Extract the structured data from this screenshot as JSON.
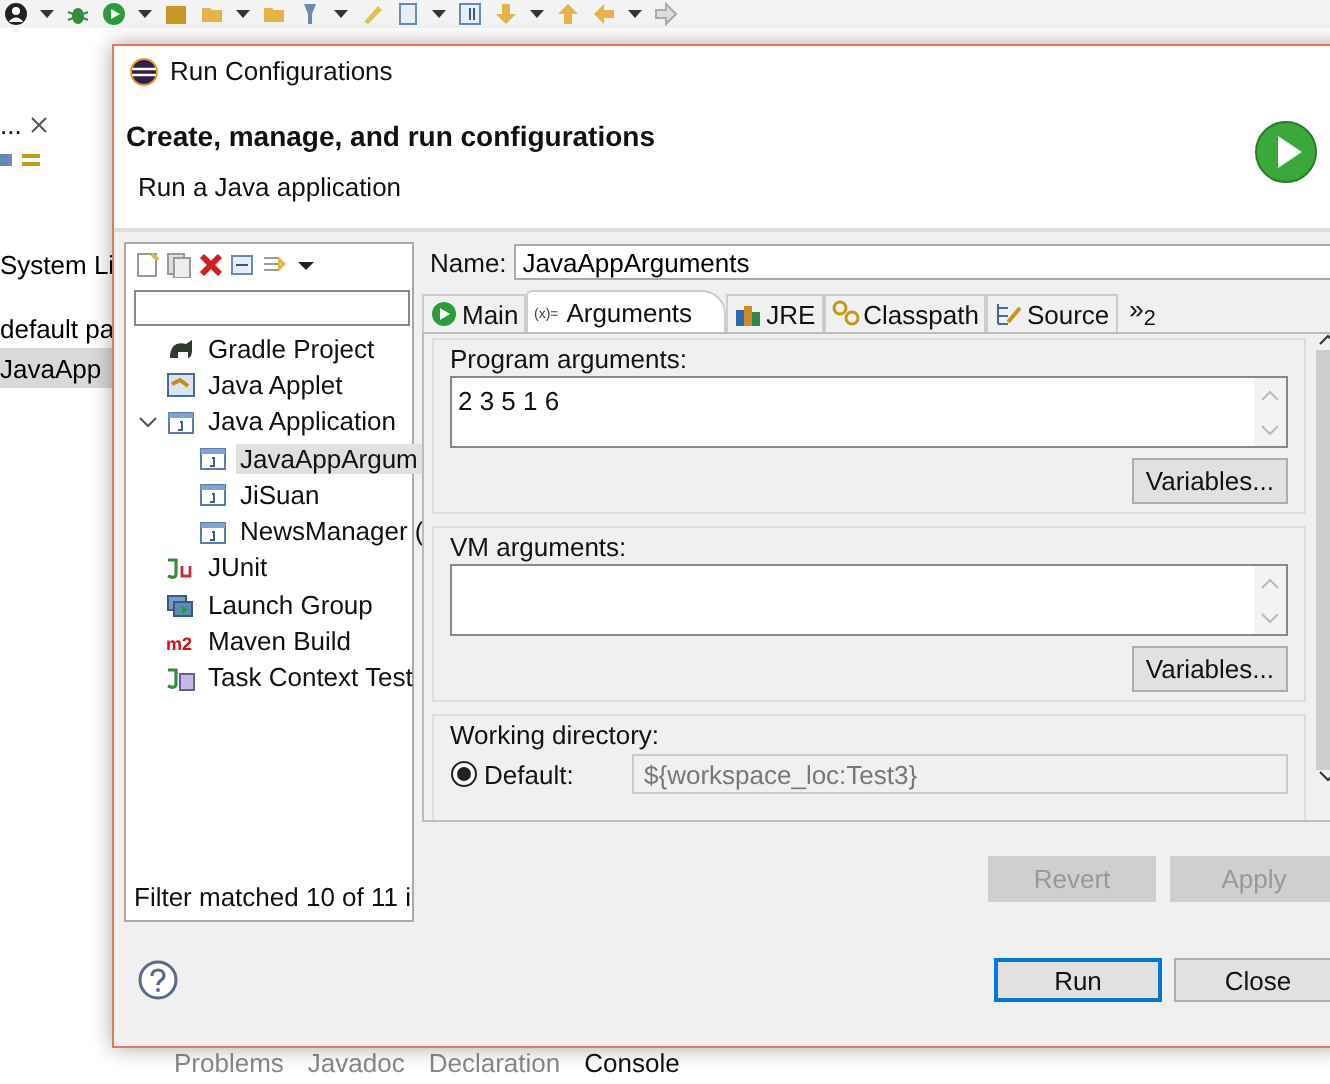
{
  "ide": {
    "side_tab": {
      "label": "..."
    },
    "side_items": [
      {
        "label": "System Li",
        "selected": false
      },
      {
        "label": "default pa",
        "selected": false
      },
      {
        "label": "JavaApp",
        "selected": true
      }
    ],
    "bottom_tabs": [
      {
        "label": "Problems",
        "selected": false
      },
      {
        "label": "Javadoc",
        "selected": false
      },
      {
        "label": "Declaration",
        "selected": false
      },
      {
        "label": "Console",
        "selected": true
      }
    ]
  },
  "dialog": {
    "title": "Run Configurations",
    "header": {
      "title": "Create, manage, and run configurations",
      "subtitle": "Run a Java application"
    },
    "tree": [
      {
        "label": "Gradle Project",
        "kind": "gradle",
        "selected": false
      },
      {
        "label": "Java Applet",
        "kind": "applet",
        "selected": false
      },
      {
        "label": "Java Application",
        "kind": "application",
        "selected": false,
        "expanded": true,
        "children": [
          {
            "label": "JavaAppArgum",
            "kind": "application",
            "selected": true
          },
          {
            "label": "JiSuan",
            "kind": "application",
            "selected": false
          },
          {
            "label": "NewsManager (",
            "kind": "application",
            "selected": false
          }
        ]
      },
      {
        "label": "JUnit",
        "kind": "junit",
        "selected": false
      },
      {
        "label": "Launch Group",
        "kind": "launch",
        "selected": false
      },
      {
        "label": "Maven Build",
        "kind": "maven",
        "icon_text": "m2",
        "selected": false
      },
      {
        "label": "Task Context Test",
        "kind": "task",
        "selected": false
      }
    ],
    "filter_status": "Filter matched 10 of 11 i",
    "name_label": "Name:",
    "name_value": "JavaAppArguments",
    "tabs": [
      {
        "label": "Main",
        "kind": "main",
        "selected": false
      },
      {
        "label": "Arguments",
        "kind": "arguments",
        "icon_text": "(x)=",
        "selected": true
      },
      {
        "label": "JRE",
        "kind": "jre",
        "selected": false
      },
      {
        "label": "Classpath",
        "kind": "classpath",
        "selected": false
      },
      {
        "label": "Source",
        "kind": "source",
        "selected": false
      }
    ],
    "tabs_overflow": "»$_{2}$",
    "program_arguments": {
      "label": "Program arguments:",
      "value": "2 3 5 1 6",
      "button": "Variables..."
    },
    "vm_arguments": {
      "label": "VM arguments:",
      "button": "Variables..."
    },
    "working_directory": {
      "label": "Working directory:",
      "default_label": "Default:",
      "default_selected": true,
      "value": "${workspace_loc:Test3}"
    },
    "buttons": [
      {
        "label": "Revert",
        "disabled": true
      },
      {
        "label": "Apply",
        "disabled": true
      }
    ],
    "footer_buttons": [
      {
        "label": "Run",
        "default": true
      },
      {
        "label": "Close",
        "default": false
      }
    ]
  }
}
